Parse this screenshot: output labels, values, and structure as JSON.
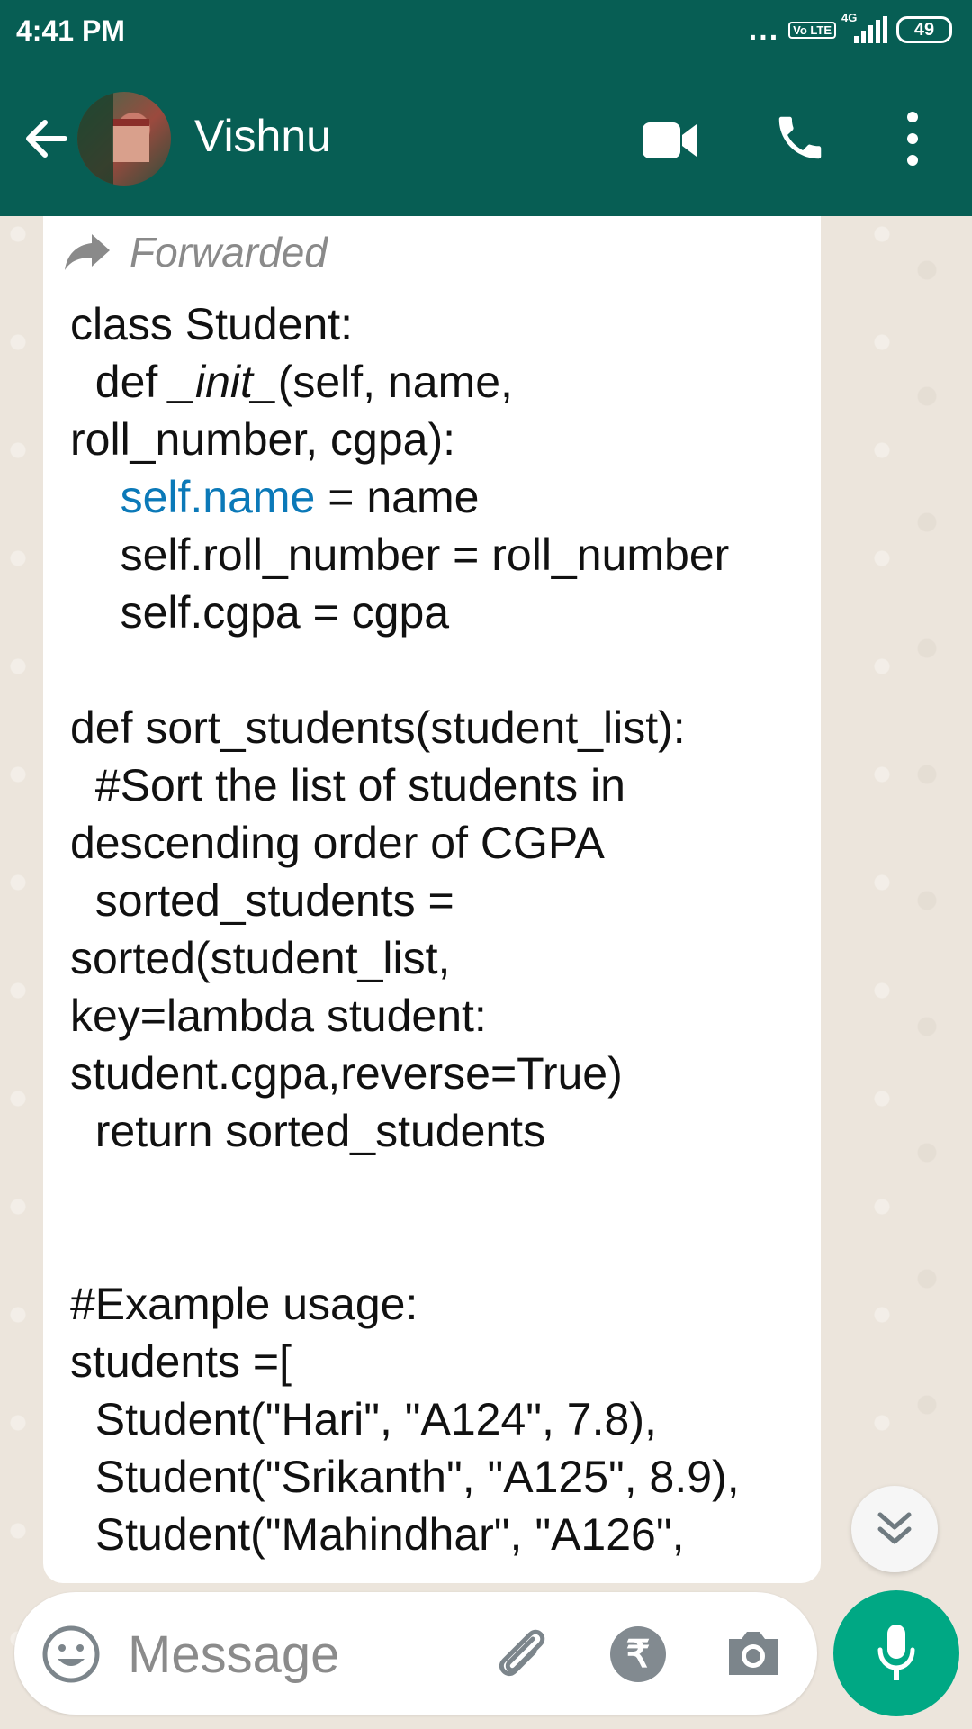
{
  "status_bar": {
    "time": "4:41 PM",
    "dots": "...",
    "volte": "Vo LTE",
    "network": "4G",
    "battery": "49"
  },
  "header": {
    "contact_name": "Vishnu"
  },
  "message": {
    "forwarded_label": "Forwarded",
    "lines": [
      "class Student:",
      "  def _init_(self, name,",
      "roll_number, cgpa):",
      "    self.name = name",
      "    self.roll_number = roll_number",
      "    self.cgpa = cgpa",
      "",
      "def sort_students(student_list):",
      "  #Sort the list of students in",
      "descending order of CGPA",
      "  sorted_students =",
      "sorted(student_list,",
      "key=lambda student:",
      "student.cgpa,reverse=True)",
      "  return sorted_students",
      "",
      "",
      "#Example usage:",
      "students =[",
      "  Student(\"Hari\", \"A124\", 7.8),",
      "  Student(\"Srikanth\", \"A125\", 8.9),",
      "  Student(\"Mahindhar\", \"A126\","
    ]
  },
  "composer": {
    "placeholder": "Message",
    "rupee_symbol": "₹"
  },
  "colors": {
    "header": "#075e54",
    "accent": "#00a884",
    "link": "#0b79b8"
  }
}
